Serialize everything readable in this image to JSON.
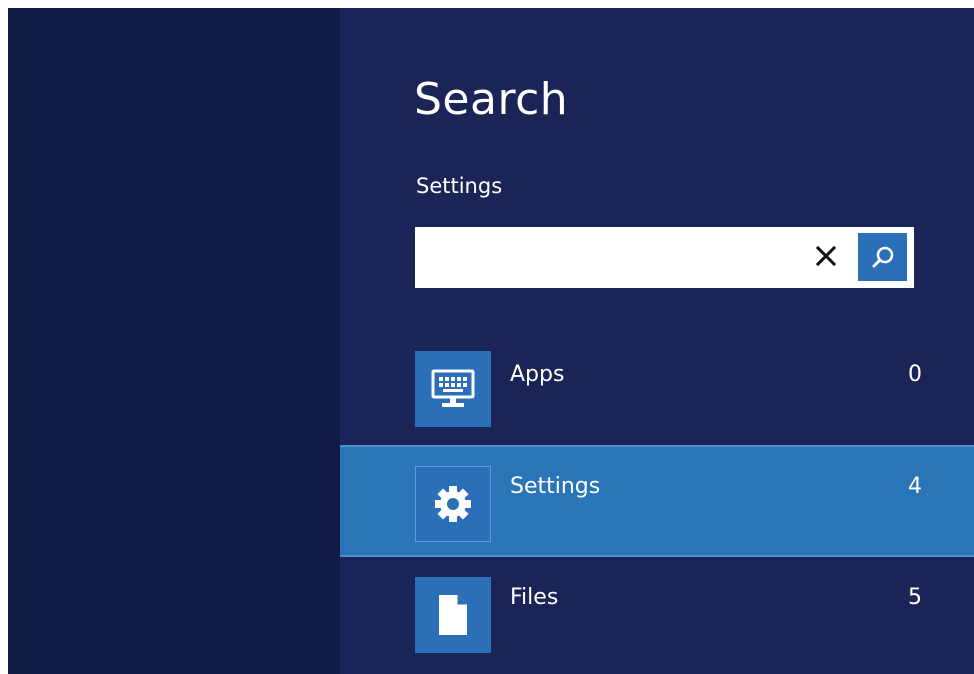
{
  "charm": {
    "title": "Search",
    "scope": "Settings"
  },
  "search": {
    "value": "",
    "placeholder": "",
    "clear_icon": "close-icon",
    "submit_icon": "search-icon"
  },
  "results": [
    {
      "label": "Apps",
      "count": "0",
      "icon": "keyboard-monitor-icon",
      "selected": false
    },
    {
      "label": "Settings",
      "count": "4",
      "icon": "gear-icon",
      "selected": true
    },
    {
      "label": "Files",
      "count": "5",
      "icon": "file-icon",
      "selected": false
    }
  ],
  "colors": {
    "background_left": "#0f1b44",
    "charm_background": "#1b2456",
    "accent": "#2b6fb8",
    "selected_row": "#2a74b8"
  }
}
